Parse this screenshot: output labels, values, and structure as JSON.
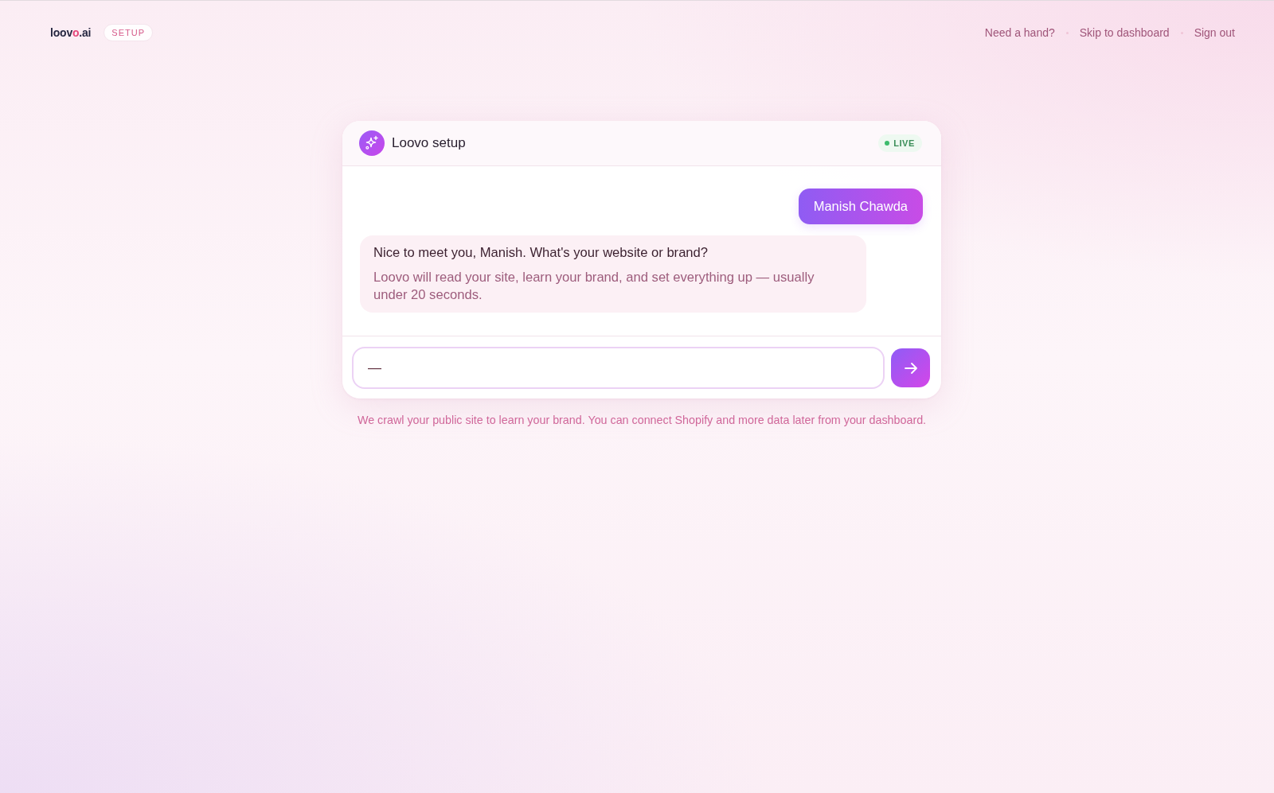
{
  "header": {
    "logo": [
      {
        "text": "loov",
        "accent": false
      },
      {
        "text": "o",
        "accent": true
      },
      {
        "text": ".ai",
        "accent": false
      }
    ],
    "badge": "SETUP",
    "nav": [
      "Need a hand?",
      "Skip to dashboard",
      "Sign out"
    ]
  },
  "chat": {
    "title": "Loovo setup",
    "status": "LIVE",
    "messages": [
      {
        "kind": "user",
        "text": "Manish Chawda"
      },
      {
        "kind": "assistant",
        "text": "Nice to meet you, Manish. What's your website or brand?",
        "note": "Loovo will read your site, learn your brand, and set everything up — usually under 20 seconds."
      }
    ],
    "composer": {
      "value": "—"
    }
  },
  "footnote": "We crawl your public site to learn your brand. You can connect Shopify and more data later from your dashboard."
}
